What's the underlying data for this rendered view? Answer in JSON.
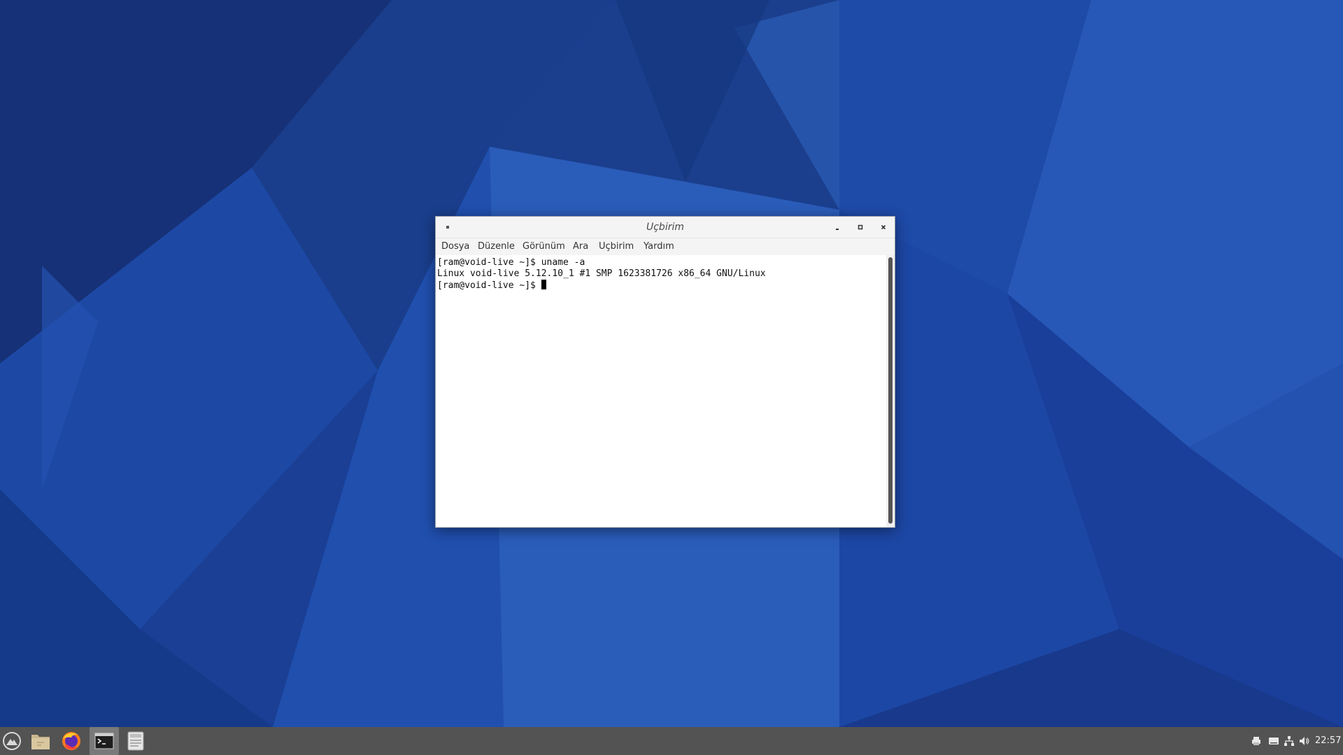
{
  "window": {
    "title": "Uçbirim",
    "menu": [
      "Dosya",
      "Düzenle",
      "Görünüm",
      "Ara",
      "Uçbirim",
      "Yardım"
    ],
    "controls": {
      "minimize_icon": "minimize-icon",
      "maximize_icon": "maximize-icon",
      "close_icon": "close-icon"
    }
  },
  "terminal": {
    "lines": [
      "[ram@void-live ~]$ uname -a",
      "Linux void-live 5.12.10_1 #1 SMP 1623381726 x86_64 GNU/Linux",
      "[ram@void-live ~]$ "
    ]
  },
  "taskbar": {
    "launchers": [
      {
        "icon": "app-menu-icon"
      },
      {
        "icon": "file-manager-icon"
      },
      {
        "icon": "firefox-icon"
      },
      {
        "icon": "terminal-icon",
        "active": true
      },
      {
        "icon": "text-editor-icon"
      }
    ],
    "tray": [
      "printer-icon",
      "keyboard-icon",
      "network-icon",
      "volume-icon"
    ],
    "clock": "22:57"
  },
  "colors": {
    "wallpaper_base": "#1a3e8f",
    "taskbar": "#535353",
    "terminal_bg": "#ffffff"
  }
}
